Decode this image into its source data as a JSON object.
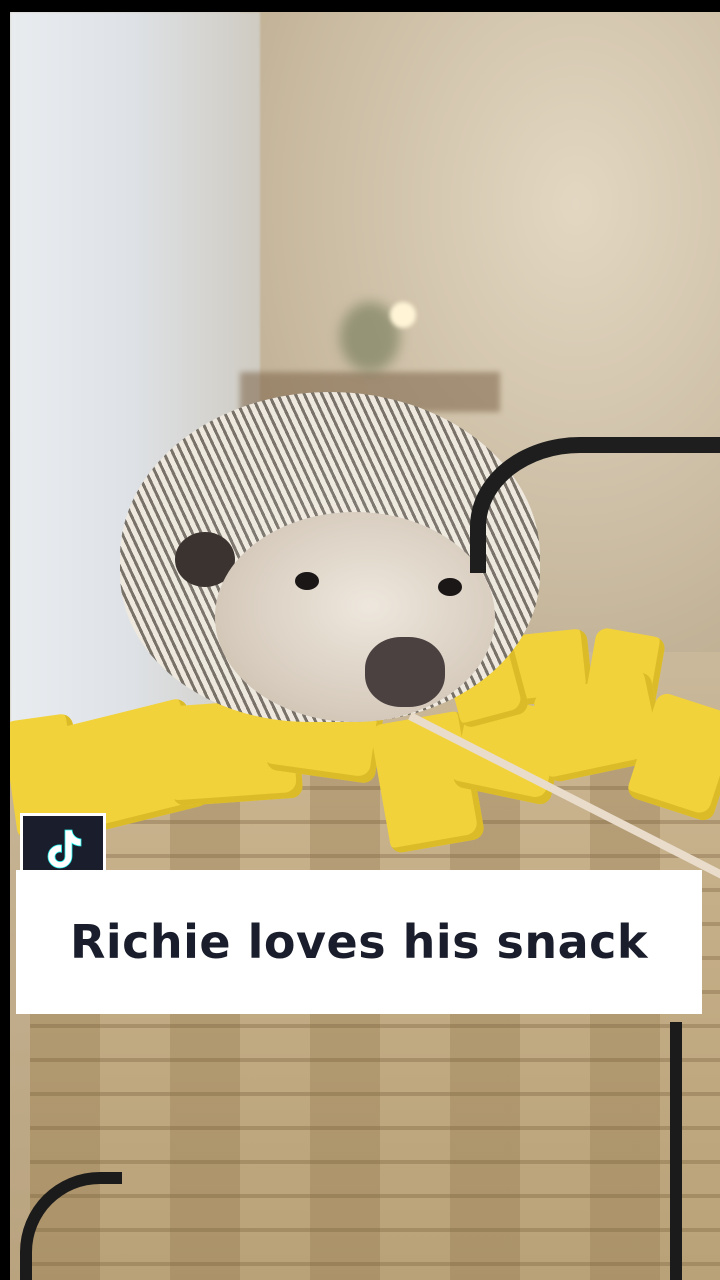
{
  "caption": {
    "text": "Richie loves his snack"
  },
  "logo": {
    "icon": "tiktok-icon"
  },
  "colors": {
    "caption_background": "#ffffff",
    "caption_text": "#1a1d2b",
    "logo_background": "#1a1d2b",
    "blanket_yellow": "#f2d23a"
  }
}
